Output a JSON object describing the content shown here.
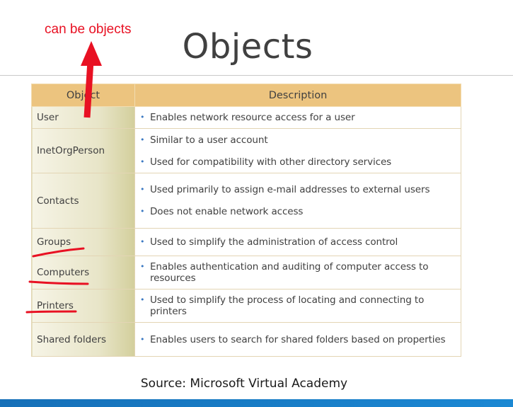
{
  "slide": {
    "title": "Objects",
    "annotation": "can be objects",
    "source": "Source: Microsoft Virtual Academy"
  },
  "table": {
    "headers": [
      "Object",
      "Description"
    ],
    "rows": [
      {
        "object": "User",
        "bullets": [
          "Enables network resource access for a user"
        ]
      },
      {
        "object": "InetOrgPerson",
        "bullets": [
          "Similar to a user account",
          "Used for compatibility with other directory services"
        ]
      },
      {
        "object": "Contacts",
        "bullets": [
          "Used primarily to assign e-mail addresses to external users",
          "Does not enable network access"
        ]
      },
      {
        "object": "Groups",
        "bullets": [
          "Used to simplify the administration of access control"
        ]
      },
      {
        "object": "Computers",
        "bullets": [
          "Enables authentication and auditing of computer access to resources"
        ]
      },
      {
        "object": "Printers",
        "bullets": [
          "Used to simplify the process of locating and connecting to printers"
        ]
      },
      {
        "object": "Shared folders",
        "bullets": [
          "Enables users to search for shared folders based on properties"
        ]
      }
    ]
  },
  "colors": {
    "annotation": "#e81123",
    "header_fill": "#ecc47f",
    "bullet": "#3a78c2",
    "footer_bar": "#1670b8"
  }
}
